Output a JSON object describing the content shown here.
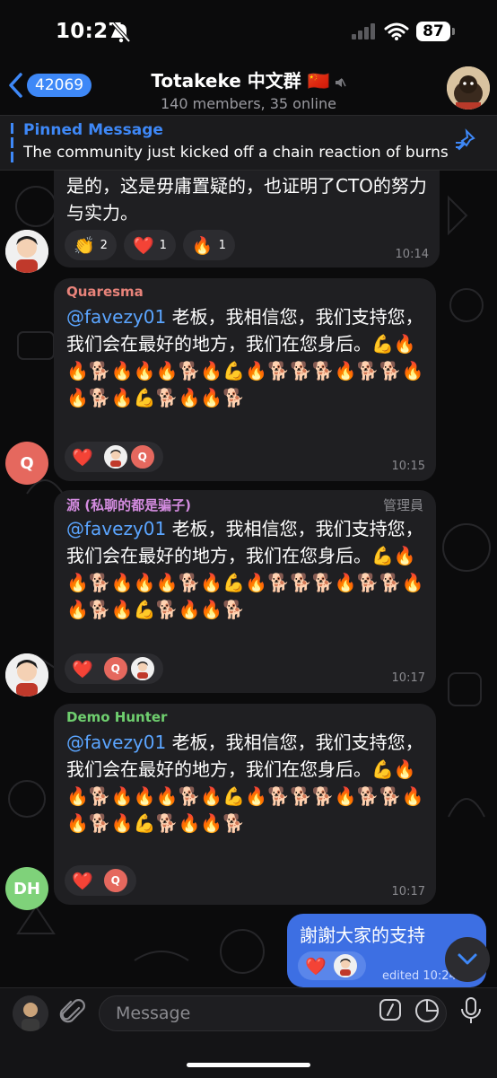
{
  "status": {
    "time": "10:27",
    "battery": "87"
  },
  "header": {
    "back_count": "42069",
    "title": "Totakeke 中文群 🇨🇳",
    "subtitle": "140 members, 35 online"
  },
  "pinned": {
    "title": "Pinned Message",
    "text": "The community just kicked off a chain reaction of burns"
  },
  "messages": [
    {
      "text": "是的，这是毋庸置疑的，也证明了CTO的努力与实力。",
      "reactions": [
        {
          "emoji": "👏",
          "count": "2"
        },
        {
          "emoji": "❤️",
          "count": "1"
        },
        {
          "emoji": "🔥",
          "count": "1"
        }
      ],
      "time": "10:14"
    },
    {
      "sender": "Quaresma",
      "mention": "@favezy01",
      "text": " 老板，我相信您，我们支持您，我们会在最好的地方，我们在您身后。💪🔥🔥🐕🔥🔥🔥🐕🔥💪🔥🐕🐕🐕🔥🐕🐕🔥🔥🐕🔥💪🐕🔥🔥🐕",
      "reaction_heart": "❤️",
      "reaction_initial": "Q",
      "time": "10:15",
      "avatar_initial": "Q"
    },
    {
      "sender": "源 (私聊的都是骗子)",
      "role": "管理員",
      "mention": "@favezy01",
      "text": " 老板，我相信您，我们支持您，我们会在最好的地方，我们在您身后。💪🔥🔥🐕🔥🔥🔥🐕🔥💪🔥🐕🐕🐕🔥🐕🐕🔥🔥🐕🔥💪🐕🔥🔥🐕",
      "reaction_heart": "❤️",
      "reaction_initial": "Q",
      "time": "10:17"
    },
    {
      "sender": "Demo Hunter",
      "mention": "@favezy01",
      "text": " 老板，我相信您，我们支持您，我们会在最好的地方，我们在您身后。💪🔥🔥🐕🔥🔥🔥🐕🔥💪🔥🐕🐕🐕🔥🐕🐕🔥🔥🐕🔥💪🐕🔥🔥🐕",
      "reaction_heart": "❤️",
      "reaction_initial": "Q",
      "time": "10:17",
      "avatar_initial": "DH"
    }
  ],
  "outgoing": {
    "text": "謝謝大家的支持",
    "reaction_heart": "❤️",
    "time": "edited 10:24"
  },
  "input": {
    "placeholder": "Message"
  },
  "colors": {
    "accent": "#3e88f7",
    "quaresma": "#e8837a",
    "yuan": "#d48ce0",
    "demo_hunter": "#6fcf6f",
    "avatar_q": "#e5685e",
    "avatar_dh": "#7fd27a",
    "outgoing": "#3d6fe3"
  }
}
